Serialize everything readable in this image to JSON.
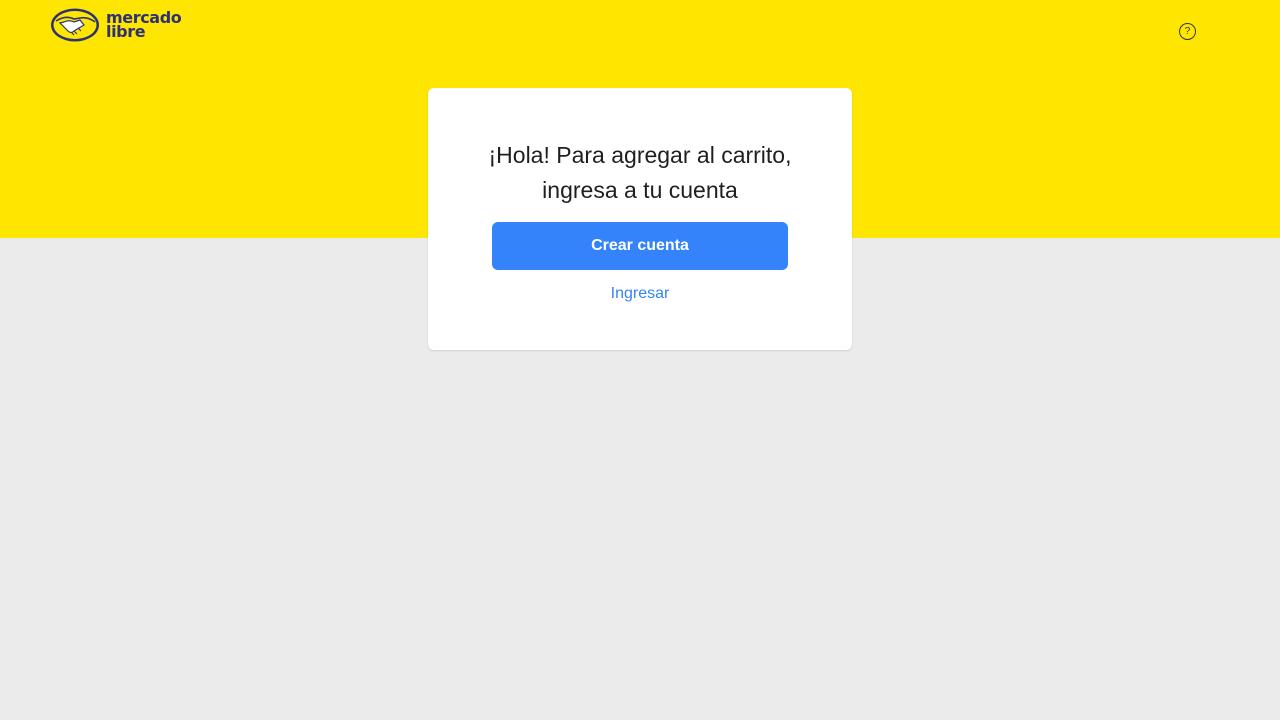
{
  "header": {
    "logo": {
      "icon": "handshake-icon",
      "line1": "mercado",
      "line2": "libre"
    },
    "help_icon": "question-circle-icon",
    "help_glyph": "?"
  },
  "card": {
    "title": "¡Hola! Para agregar al carrito, ingresa a tu cuenta",
    "create_account_label": "Crear cuenta",
    "login_label": "Ingresar"
  },
  "colors": {
    "header_bg": "#ffe600",
    "page_bg": "#ebebeb",
    "primary": "#3483fa",
    "brand_navy": "#2d3277"
  }
}
